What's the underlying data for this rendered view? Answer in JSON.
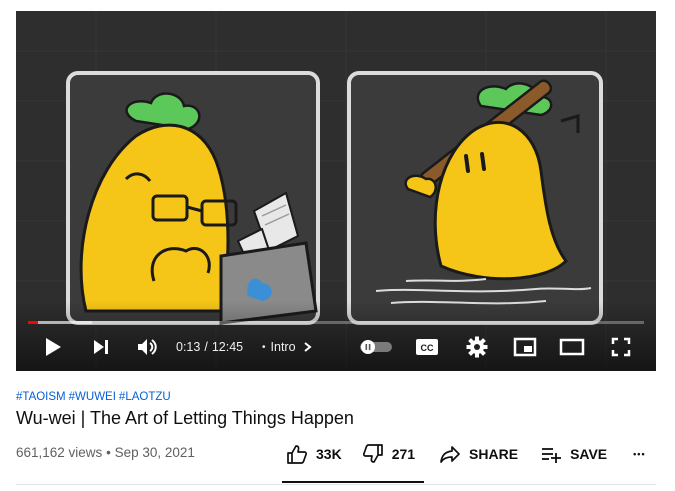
{
  "player": {
    "current_time": "0:13",
    "separator": "/",
    "duration": "12:45",
    "chapter_bullet": "•",
    "chapter": "Intro",
    "played_fraction": 0.017,
    "icons": {
      "play": "play-icon",
      "next": "next-icon",
      "volume": "volume-icon",
      "autoplay": "autoplay-toggle-icon",
      "captions": "cc-icon",
      "settings": "gear-icon",
      "miniplayer": "miniplayer-icon",
      "theater": "theater-mode-icon",
      "fullscreen": "fullscreen-icon"
    },
    "cc_label": "CC"
  },
  "video": {
    "hashtags": [
      "#TAOISM",
      "#WUWEI",
      "#LAOTZU"
    ],
    "title": "Wu-wei | The Art of Letting Things Happen",
    "views": "661,162 views",
    "meta_separator": "•",
    "date": "Sep 30, 2021"
  },
  "actions": {
    "likes": "33K",
    "dislikes": "271",
    "share": "SHARE",
    "save": "SAVE",
    "more": "•••"
  },
  "colors": {
    "accent_red": "#ff0000",
    "link_blue": "#065fd4",
    "character_yellow": "#f5c518",
    "leaf_green": "#5cc85a"
  }
}
